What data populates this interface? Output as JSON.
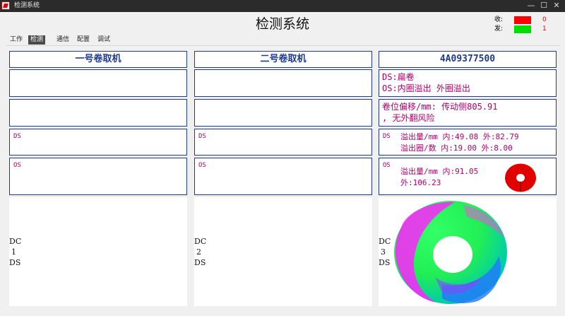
{
  "window": {
    "title": "检测系统",
    "minimize": "—",
    "maximize": "☐",
    "close": "✕"
  },
  "app_title": "检测系统",
  "signals": [
    {
      "label": "收:",
      "color": "#ff0000",
      "count": "0"
    },
    {
      "label": "发:",
      "color": "#00dd00",
      "count": "1"
    }
  ],
  "menu": [
    "工作",
    "检测",
    "通信",
    "配置",
    "调试"
  ],
  "columns": [
    {
      "header": "一号卷取机",
      "row4": "DS",
      "row5": "OS",
      "dc": [
        "DC",
        "1",
        "DS"
      ]
    },
    {
      "header": "二号卷取机",
      "row4": "DS",
      "row5": "OS",
      "dc": [
        "DC",
        "2",
        "DS"
      ]
    },
    {
      "header": "4A09377500",
      "row2": [
        "DS:扁卷",
        "OS:内圈溢出 外圈溢出"
      ],
      "row3": [
        "卷位偏移/mm: 传动侧805.91",
        ", 无外翻风险"
      ],
      "row4": {
        "side": "DS",
        "line1": "溢出量/mm 内:49.08 外:82.79",
        "line2": "溢出圈/数 内:19.00 外:8.00"
      },
      "row5": {
        "side": "OS",
        "line1": "溢出量/mm 内:91.05",
        "line2": "外:106.23"
      },
      "dc": [
        "DC",
        "3",
        "DS"
      ]
    }
  ],
  "colors": {
    "panel_border": "#1f3a8a",
    "header_text": "#1f3a8a",
    "magenta_text": "#b0006c",
    "ring_red": "#e00000"
  },
  "icons": [
    "app-icon",
    "coil-ring-small",
    "coil-scan-image"
  ]
}
